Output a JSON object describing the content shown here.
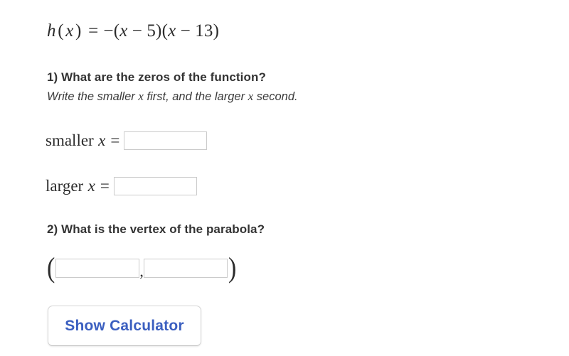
{
  "problem": {
    "equation": {
      "fn_name": "h",
      "open1": "(",
      "var1": "x",
      "close1": ")",
      "equals": "=",
      "neg": "−",
      "open2": "(",
      "var2": "x",
      "minus1": "−",
      "num1": "5",
      "close2": ")",
      "open3": "(",
      "var3": "x",
      "minus2": "−",
      "num2": "13",
      "close3": ")",
      "plain_text": "h(x) = −(x − 5)(x − 13)"
    }
  },
  "question1": {
    "prompt": "1) What are the zeros of the function?",
    "subtitle_part1": "Write the smaller ",
    "subtitle_var1": "x",
    "subtitle_part2": " first, and the larger ",
    "subtitle_var2": "x",
    "subtitle_part3": " second.",
    "subtitle_plain": "Write the smaller x first, and the larger x second.",
    "smaller": {
      "label_word": "smaller",
      "label_var": "x",
      "equals": "=",
      "value": "",
      "placeholder": ""
    },
    "larger": {
      "label_word": "larger",
      "label_var": "x",
      "equals": "=",
      "value": "",
      "placeholder": ""
    }
  },
  "question2": {
    "prompt": "2) What is the vertex of the parabola?",
    "vertex": {
      "open_paren": "(",
      "comma": ",",
      "close_paren": ")",
      "x_value": "",
      "x_placeholder": "",
      "y_value": "",
      "y_placeholder": ""
    }
  },
  "controls": {
    "show_calculator_label": "Show Calculator"
  },
  "colors": {
    "background": "#ffffff",
    "text": "#333333",
    "math_text": "#2b2b2b",
    "input_border": "#cbcbcb",
    "button_text": "#3b5fc0",
    "button_border": "#d6d6d6"
  }
}
